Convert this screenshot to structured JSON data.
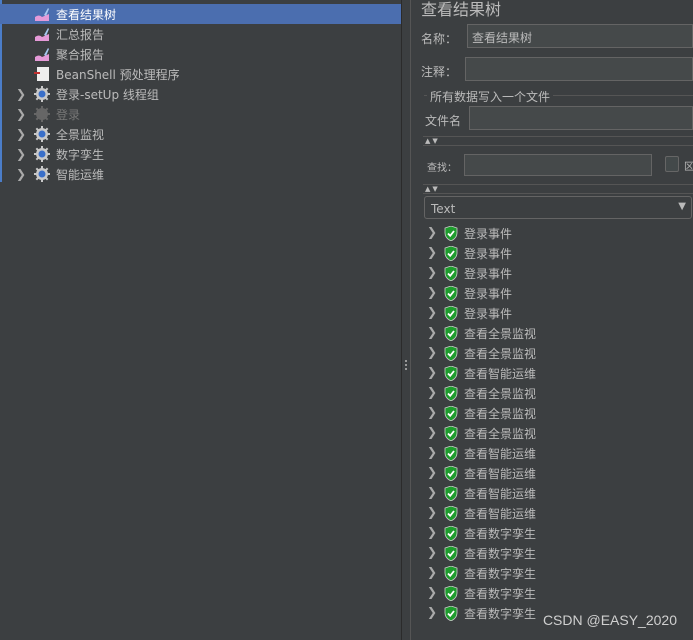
{
  "tree": {
    "items": [
      {
        "label": "查看结果树",
        "icon": "listener-icon",
        "selected": true,
        "expandable": false
      },
      {
        "label": "汇总报告",
        "icon": "listener-icon",
        "expandable": false
      },
      {
        "label": "聚合报告",
        "icon": "listener-icon",
        "expandable": false
      },
      {
        "label": "BeanShell 预处理程序",
        "icon": "preprocessor-icon",
        "expandable": false
      },
      {
        "label": "登录-setUp 线程组",
        "icon": "thread-group-gear-icon",
        "expandable": true
      },
      {
        "label": "登录",
        "icon": "thread-group-gear-icon",
        "expandable": true,
        "disabled": true
      },
      {
        "label": "全景监视",
        "icon": "thread-group-gear-icon",
        "expandable": true
      },
      {
        "label": "数字孪生",
        "icon": "thread-group-gear-icon",
        "expandable": true
      },
      {
        "label": "智能运维",
        "icon": "thread-group-gear-icon",
        "expandable": true
      }
    ]
  },
  "panel": {
    "title": "查看结果树",
    "name_label": "名称：",
    "name_value": "查看结果树",
    "comment_label": "注释：",
    "comment_value": "",
    "file_group_label": "所有数据写入一个文件",
    "filename_label": "文件名",
    "filename_value": "",
    "search_label": "查找：",
    "search_value": "",
    "case_label": "区",
    "renderer": "Text"
  },
  "results": [
    "登录事件",
    "登录事件",
    "登录事件",
    "登录事件",
    "登录事件",
    "查看全景监视",
    "查看全景监视",
    "查看智能运维",
    "查看全景监视",
    "查看全景监视",
    "查看全景监视",
    "查看智能运维",
    "查看智能运维",
    "查看智能运维",
    "查看智能运维",
    "查看数字孪生",
    "查看数字孪生",
    "查看数字孪生",
    "查看数字孪生",
    "查看数字孪生"
  ],
  "watermark": "CSDN @EASY_2020",
  "colors": {
    "selection": "#4b6eaf",
    "background": "#3c3f41",
    "success": "#1f9c2e"
  }
}
